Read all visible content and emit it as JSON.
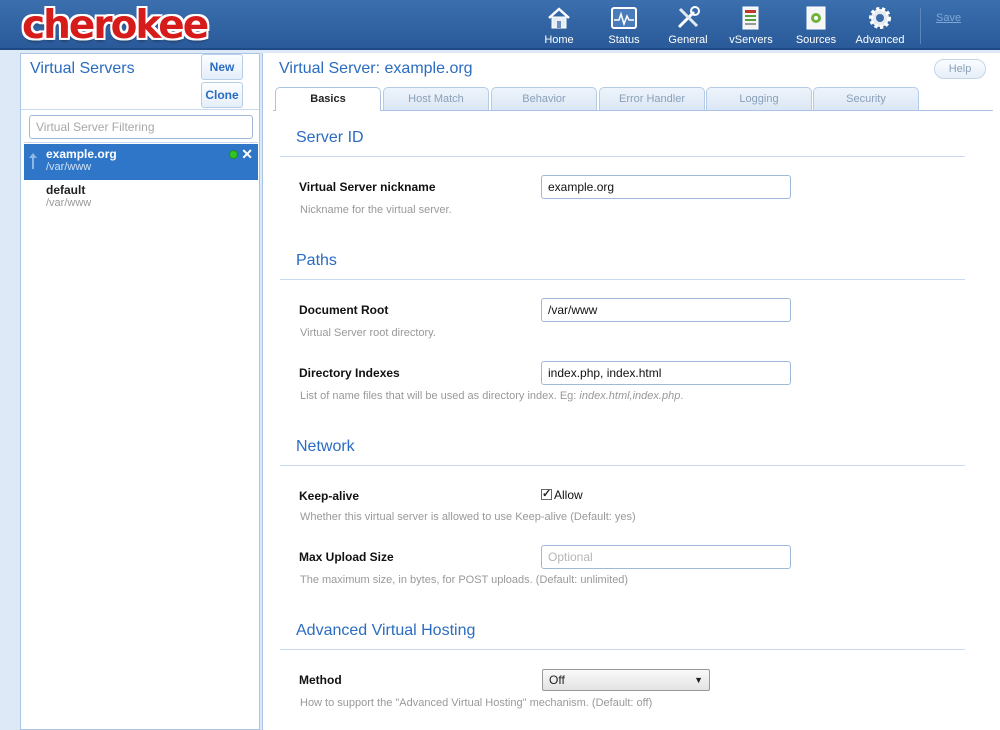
{
  "app": {
    "logo_text": "cherokee"
  },
  "nav": {
    "items": [
      {
        "label": "Home",
        "icon": "home-icon"
      },
      {
        "label": "Status",
        "icon": "status-icon"
      },
      {
        "label": "General",
        "icon": "tools-icon"
      },
      {
        "label": "vServers",
        "icon": "vservers-icon"
      },
      {
        "label": "Sources",
        "icon": "sources-icon"
      },
      {
        "label": "Advanced",
        "icon": "gear-icon"
      }
    ],
    "save_label": "Save"
  },
  "sidebar": {
    "title": "Virtual Servers",
    "new_label": "New",
    "clone_label": "Clone",
    "filter_placeholder": "Virtual Server Filtering",
    "servers": [
      {
        "name": "example.org",
        "path": "/var/www",
        "selected": true
      },
      {
        "name": "default",
        "path": "/var/www",
        "selected": false
      }
    ]
  },
  "main": {
    "title": "Virtual Server: example.org",
    "help_label": "Help",
    "tabs": [
      "Basics",
      "Host Match",
      "Behavior",
      "Error Handler",
      "Logging",
      "Security"
    ],
    "active_tab": "Basics",
    "sections": {
      "server_id": {
        "title": "Server ID",
        "nickname_label": "Virtual Server nickname",
        "nickname_value": "example.org",
        "nickname_help": "Nickname for the virtual server."
      },
      "paths": {
        "title": "Paths",
        "docroot_label": "Document Root",
        "docroot_value": "/var/www",
        "docroot_help": "Virtual Server root directory.",
        "indexes_label": "Directory Indexes",
        "indexes_value": "index.php, index.html",
        "indexes_help_prefix": "List of name files that will be used as directory index. Eg: ",
        "indexes_help_example": "index.html,index.php",
        "indexes_help_suffix": "."
      },
      "network": {
        "title": "Network",
        "keepalive_label": "Keep-alive",
        "keepalive_checkbox_label": "Allow",
        "keepalive_checked": true,
        "keepalive_help": "Whether this virtual server is allowed to use Keep-alive (Default: yes)",
        "upload_label": "Max Upload Size",
        "upload_placeholder": "Optional",
        "upload_value": "",
        "upload_help": "The maximum size, in bytes, for POST uploads. (Default: unlimited)"
      },
      "advanced_hosting": {
        "title": "Advanced Virtual Hosting",
        "method_label": "Method",
        "method_value": "Off",
        "method_help": "How to support the \"Advanced Virtual Hosting\" mechanism. (Default: off)"
      }
    }
  },
  "colors": {
    "accent": "#2a6cc1",
    "header": "#2a5a99",
    "selected": "#2f76c9",
    "logo": "#d61b1b"
  }
}
